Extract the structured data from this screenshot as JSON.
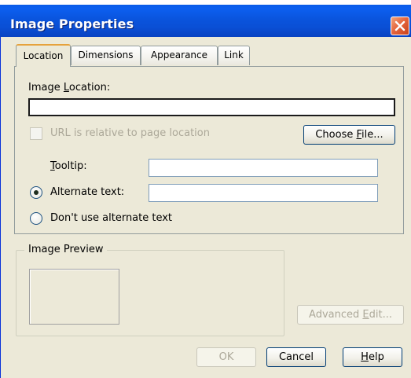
{
  "window": {
    "title": "Image Properties"
  },
  "tabs": [
    {
      "label": "Location",
      "active": true
    },
    {
      "label": "Dimensions",
      "active": false
    },
    {
      "label": "Appearance",
      "active": false
    },
    {
      "label": "Link",
      "active": false
    }
  ],
  "location_tab": {
    "image_location_label": "Image Location:",
    "image_location_value": "",
    "relative_url_label": "URL is relative to page location",
    "relative_url_checked": false,
    "choose_file_label": "Choose File...",
    "tooltip_label": "Tooltip:",
    "tooltip_value": "",
    "alt_text_label": "Alternate text:",
    "alt_text_value": "",
    "alt_text_selected": true,
    "no_alt_text_label": "Don't use alternate text",
    "no_alt_text_selected": false
  },
  "preview": {
    "legend": "Image Preview"
  },
  "buttons": {
    "advanced_edit": "Advanced Edit...",
    "ok": "OK",
    "cancel": "Cancel",
    "help": "Help"
  },
  "colors": {
    "titlebar": "#0a54dd",
    "dialog_bg": "#ece9d8",
    "active_tab_accent": "#e6a23c",
    "close_button": "#e5673f"
  }
}
